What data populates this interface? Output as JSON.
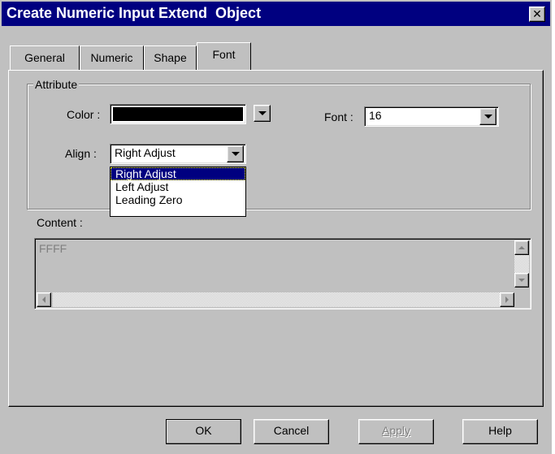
{
  "window": {
    "title": "Create Numeric Input Extend  Object",
    "close_glyph": "✕"
  },
  "tabs": [
    {
      "label": "General"
    },
    {
      "label": "Numeric"
    },
    {
      "label": "Shape"
    },
    {
      "label": "Font"
    }
  ],
  "attribute": {
    "group_label": "Attribute",
    "color_label": "Color :",
    "color_value": "#000000",
    "font_label": "Font :",
    "font_value": "16",
    "align_label": "Align :",
    "align_value": "Right Adjust",
    "align_options": [
      "Right Adjust",
      "Left Adjust",
      "Leading Zero"
    ]
  },
  "content": {
    "label": "Content :",
    "value": "FFFF"
  },
  "buttons": {
    "ok": "OK",
    "cancel": "Cancel",
    "apply": "Apply",
    "help": "Help"
  }
}
